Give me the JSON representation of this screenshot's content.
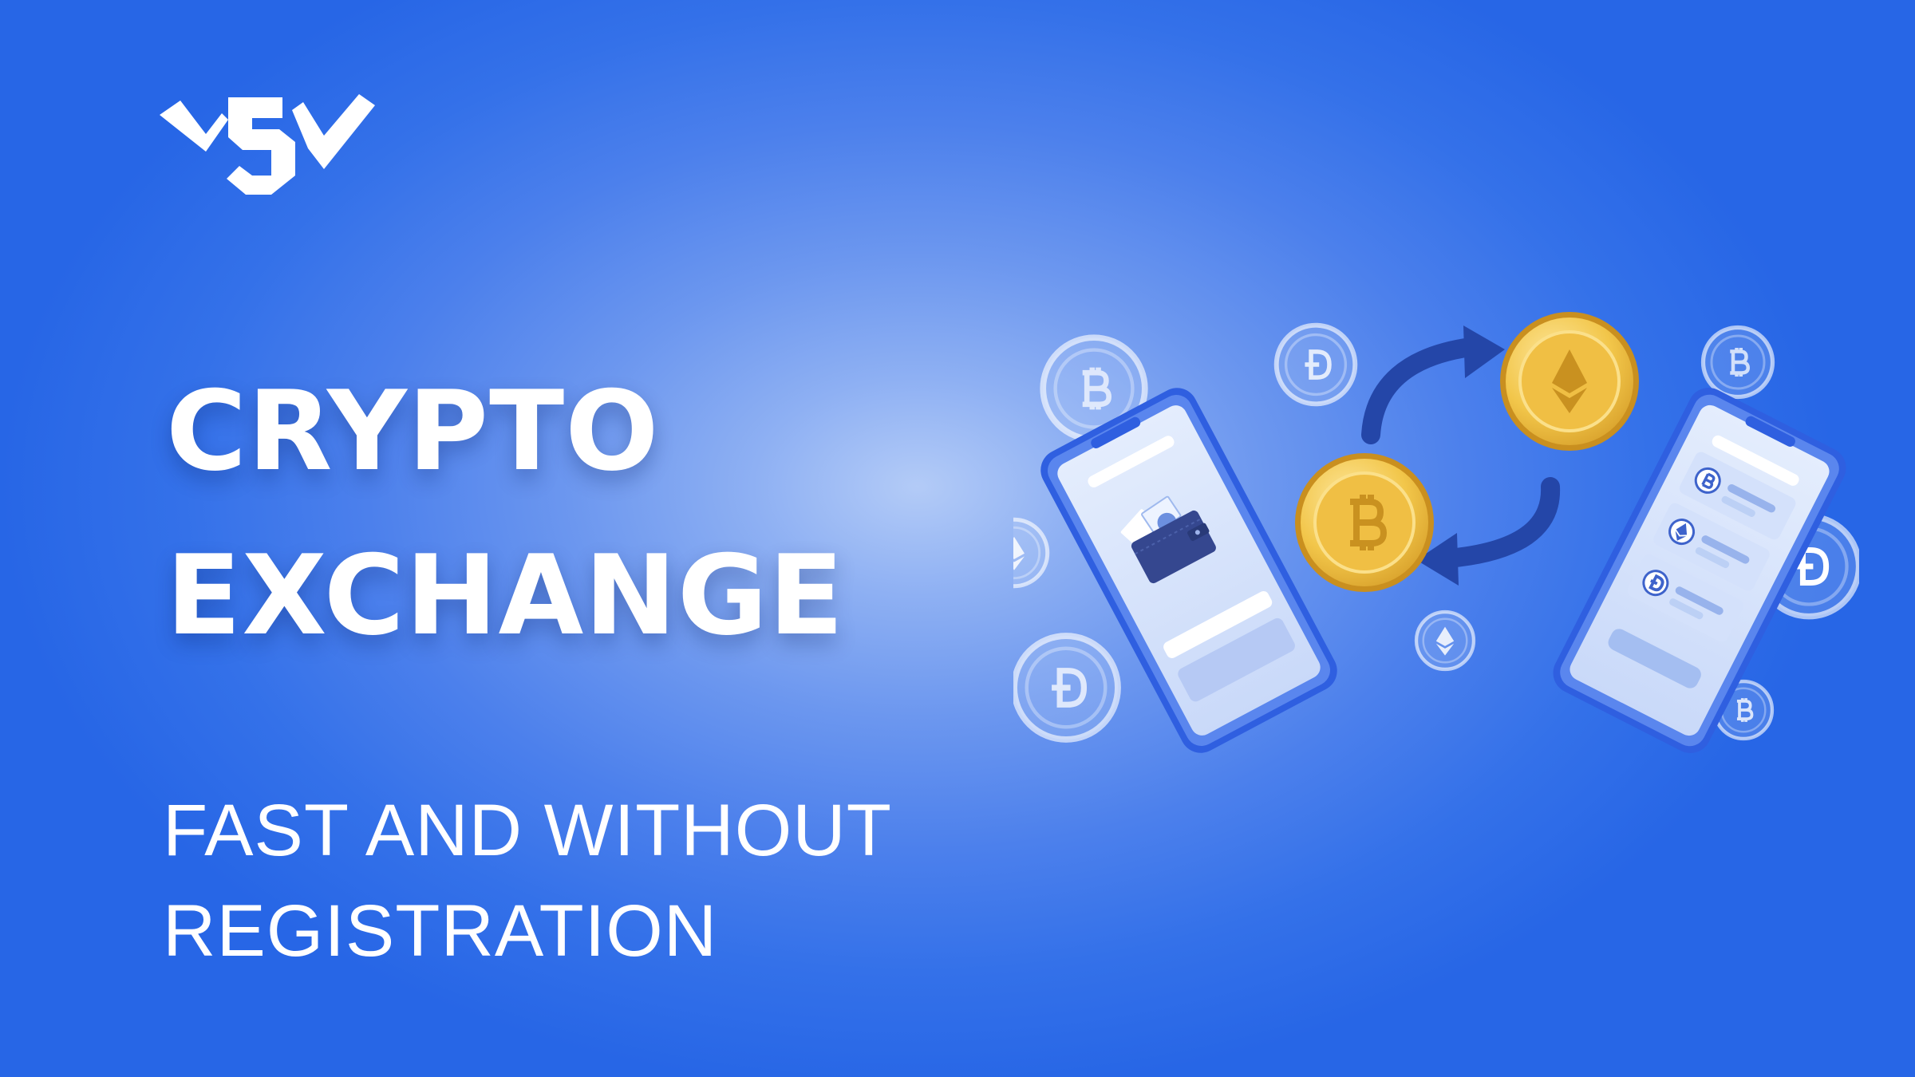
{
  "brand": {
    "logo_icon": "ws-monogram-logo-icon"
  },
  "headline": {
    "line1": "CRYPTO",
    "line2": "EXCHANGE"
  },
  "subline": {
    "line1": "FAST AND WITHOUT",
    "line2": "REGISTRATION"
  },
  "illustration": {
    "icons": [
      "smartphone-left-icon",
      "wallet-icon",
      "smartphone-right-icon",
      "bitcoin-coin-icon",
      "ethereum-coin-icon",
      "swap-arrows-icon",
      "dogecoin-badge-icon"
    ]
  },
  "colors": {
    "background": "#2766e6",
    "background_glow": "#b3cbf7",
    "text": "#ffffff",
    "coin_gold": "#e9b43a",
    "arrow_navy": "#2446a8",
    "phone_frame": "#3a6ae6"
  }
}
